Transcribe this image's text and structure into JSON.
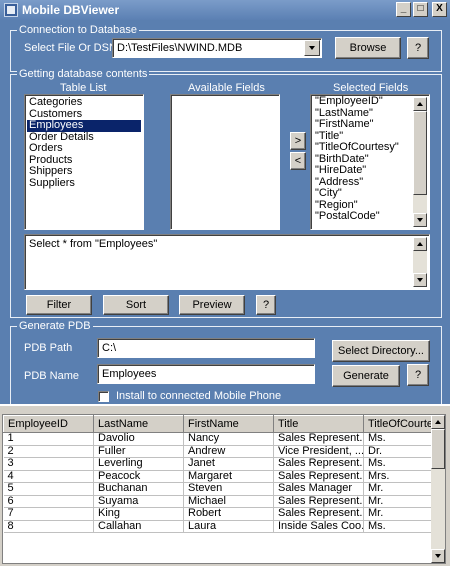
{
  "window": {
    "title": "Mobile DBViewer",
    "min": "_",
    "max": "□",
    "close": "X"
  },
  "connection": {
    "group_label": "Connection to Database",
    "dsn_label": "Select File Or DSN",
    "dsn_value": "D:\\TestFiles\\NWIND.MDB",
    "browse": "Browse",
    "help": "?"
  },
  "contents": {
    "group_label": "Getting database contents",
    "table_list_label": "Table List",
    "available_fields_label": "Available Fields",
    "selected_fields_label": "Selected Fields",
    "tables": [
      "Categories",
      "Customers",
      "Employees",
      "Order Details",
      "Orders",
      "Products",
      "Shippers",
      "Suppliers"
    ],
    "selected_table_index": 2,
    "selected_fields": [
      "\"EmployeeID\"",
      "\"LastName\"",
      "\"FirstName\"",
      "\"Title\"",
      "\"TitleOfCourtesy\"",
      "\"BirthDate\"",
      "\"HireDate\"",
      "\"Address\"",
      "\"City\"",
      "\"Region\"",
      "\"PostalCode\""
    ],
    "add_arrow": ">",
    "remove_arrow": "<",
    "query": "Select * from \"Employees\"",
    "filter": "Filter",
    "sort": "Sort",
    "preview": "Preview",
    "help": "?"
  },
  "pdb": {
    "group_label": "Generate PDB",
    "path_label": "PDB Path",
    "path_value": "C:\\",
    "select_dir": "Select Directory...",
    "name_label": "PDB Name",
    "name_value": "Employees",
    "generate": "Generate",
    "help": "?",
    "install_label": "Install to connected Mobile Phone",
    "install_checked": false
  },
  "grid": {
    "columns": [
      "EmployeeID",
      "LastName",
      "FirstName",
      "Title",
      "TitleOfCourtesy"
    ],
    "rows": [
      [
        "1",
        "Davolio",
        "Nancy",
        "Sales Represent...",
        "Ms."
      ],
      [
        "2",
        "Fuller",
        "Andrew",
        "Vice President, ...",
        "Dr."
      ],
      [
        "3",
        "Leverling",
        "Janet",
        "Sales Represent...",
        "Ms."
      ],
      [
        "4",
        "Peacock",
        "Margaret",
        "Sales Represent...",
        "Mrs."
      ],
      [
        "5",
        "Buchanan",
        "Steven",
        "Sales Manager",
        "Mr."
      ],
      [
        "6",
        "Suyama",
        "Michael",
        "Sales Represent...",
        "Mr."
      ],
      [
        "7",
        "King",
        "Robert",
        "Sales Represent...",
        "Mr."
      ],
      [
        "8",
        "Callahan",
        "Laura",
        "Inside Sales Coo...",
        "Ms."
      ]
    ]
  },
  "colors": {
    "client_bg": "#5a7fb0",
    "button_face": "#d4d0c8",
    "selection": "#0a246a"
  }
}
